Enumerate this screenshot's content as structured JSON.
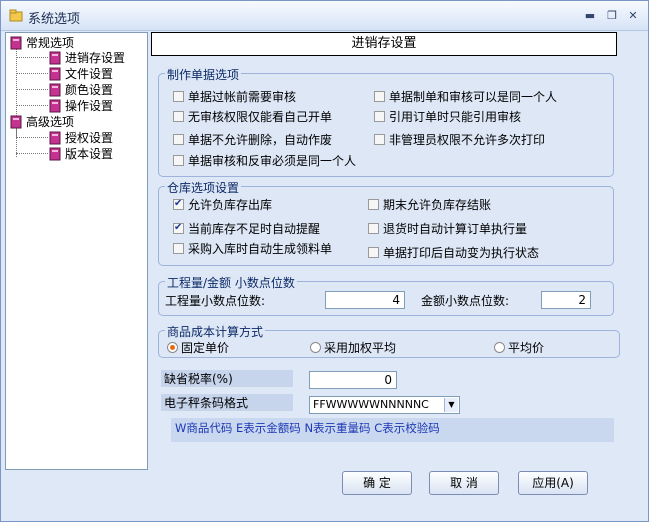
{
  "window": {
    "title": "系统选项"
  },
  "tree": {
    "nodes": [
      {
        "label": "常规选项"
      },
      {
        "label": "进销存设置"
      },
      {
        "label": "文件设置"
      },
      {
        "label": "颜色设置"
      },
      {
        "label": "操作设置"
      },
      {
        "label": "高级选项"
      },
      {
        "label": "授权设置"
      },
      {
        "label": "版本设置"
      }
    ]
  },
  "panel": {
    "title": "进销存设置"
  },
  "doc_options": {
    "legend": "制作单据选项",
    "items": [
      {
        "label": "单据过帐前需要审核",
        "checked": false
      },
      {
        "label": "单据制单和审核可以是同一个人",
        "checked": false
      },
      {
        "label": "无审核权限仅能看自己开单",
        "checked": false
      },
      {
        "label": "引用订单时只能引用审核",
        "checked": false
      },
      {
        "label": "单据不允许删除，自动作废",
        "checked": false
      },
      {
        "label": "非管理员权限不允许多次打印",
        "checked": false
      },
      {
        "label": "单据审核和反审必须是同一个人",
        "checked": false
      }
    ]
  },
  "warehouse_options": {
    "legend": "仓库选项设置",
    "items": [
      {
        "label": "允许负库存出库",
        "checked": true
      },
      {
        "label": "期末允许负库存结账",
        "checked": false
      },
      {
        "label": "当前库存不足时自动提醒",
        "checked": true
      },
      {
        "label": "退货时自动计算订单执行量",
        "checked": false
      },
      {
        "label": "采购入库时自动生成领料单",
        "checked": false
      },
      {
        "label": "单据打印后自动变为执行状态",
        "checked": false
      }
    ]
  },
  "decimal": {
    "legend": "工程量/金额  小数点位数",
    "qty_label": "工程量小数点位数:",
    "qty_value": "4",
    "amount_label": "金额小数点位数:",
    "amount_value": "2"
  },
  "cost_method": {
    "legend": "商品成本计算方式",
    "options": [
      {
        "label": "固定单价",
        "selected": true
      },
      {
        "label": "采用加权平均",
        "selected": false
      },
      {
        "label": "平均价",
        "selected": false
      }
    ]
  },
  "tax": {
    "label": "缺省税率(%)",
    "value": "0"
  },
  "barcode": {
    "label": "电子秤条码格式",
    "value": "FFWWWWWNNNNNC",
    "hint": "W商品代码 E表示金额码 N表示重量码 C表示校验码"
  },
  "buttons": {
    "ok": "确 定",
    "cancel": "取 消",
    "apply": "应用(A)"
  },
  "colors": {
    "accent": "#1d38b5",
    "group_bg": "#dde7f6"
  }
}
